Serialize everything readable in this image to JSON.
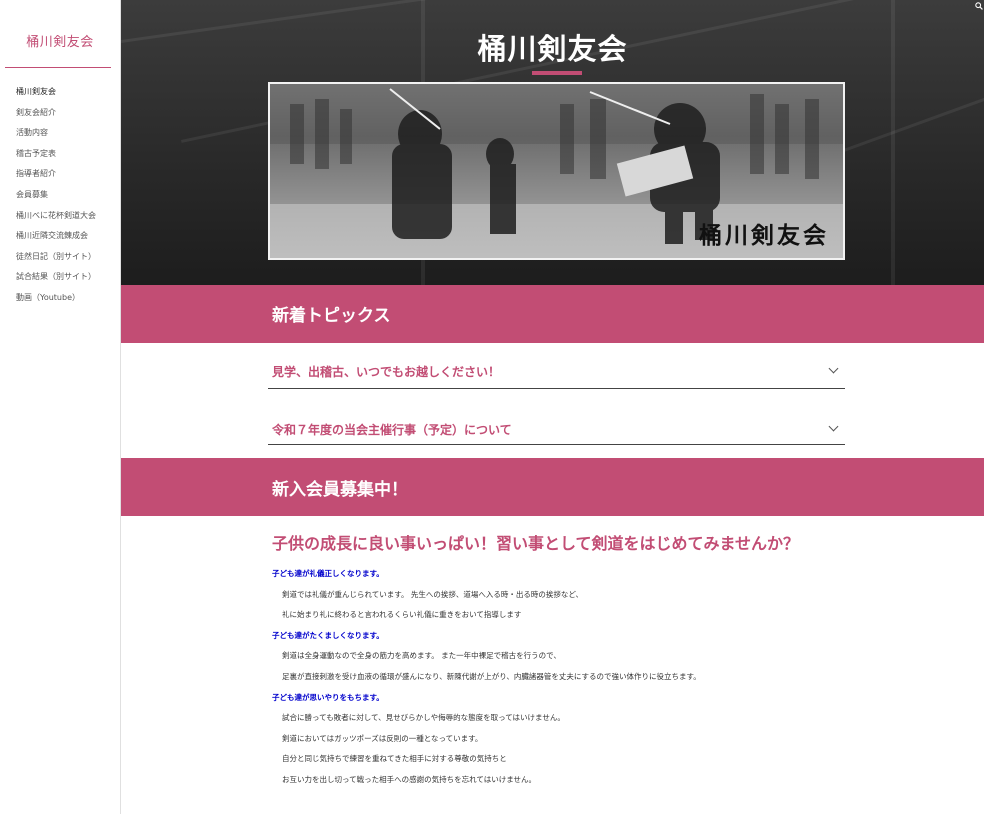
{
  "sidebar": {
    "site_title": "桶川剣友会",
    "items": [
      {
        "label": "桶川剣友会"
      },
      {
        "label": "剣友会紹介"
      },
      {
        "label": "活動内容"
      },
      {
        "label": "稽古予定表"
      },
      {
        "label": "指導者紹介"
      },
      {
        "label": "会員募集"
      },
      {
        "label": "桶川べに花杯剣道大会"
      },
      {
        "label": "桶川近隣交流錬成会"
      },
      {
        "label": "徒然日記（別サイト）"
      },
      {
        "label": "試合結果（別サイト）"
      },
      {
        "label": "動画（Youtube）"
      }
    ]
  },
  "header": {
    "title": "桶川剣友会",
    "banner_text": "桶川剣友会"
  },
  "topics": {
    "heading": "新着トピックス",
    "items": [
      {
        "label": "見学、出稽古、いつでもお越しください！"
      },
      {
        "label": "令和７年度の当会主催行事（予定）について"
      }
    ]
  },
  "recruit": {
    "heading": "新入会員募集中！",
    "headline": "子供の成長に良い事いっぱい！習い事として剣道をはじめてみませんか？",
    "lines": [
      {
        "type": "sub",
        "text": "子ども達が礼儀正しくなります。"
      },
      {
        "type": "para",
        "text": "剣道では礼儀が重んじられています。 先生への挨拶、道場へ入る時・出る時の挨拶など、"
      },
      {
        "type": "para",
        "text": "礼に始まり礼に終わると言われるくらい礼儀に重きをおいて指導します"
      },
      {
        "type": "sub",
        "text": "子ども達がたくましくなります。"
      },
      {
        "type": "para",
        "text": "剣道は全身運動なので全身の筋力を高めます。 また一年中裸足で稽古を行うので、"
      },
      {
        "type": "para",
        "text": "足裏が直接刺激を受け血液の循環が盛んになり、新陳代謝が上がり、内臓諸器管を丈夫にするので強い体作りに役立ちます。"
      },
      {
        "type": "sub",
        "text": "子ども達が思いやりをもちます。"
      },
      {
        "type": "para",
        "text": "試合に勝っても敗者に対して、見せびらかしや侮辱的な態度を取ってはいけません。"
      },
      {
        "type": "para",
        "text": "剣道においてはガッツポーズは反則の一種となっています。"
      },
      {
        "type": "para",
        "text": "自分と同じ気持ちで練習を重ねてきた相手に対する尊敬の気持ちと"
      },
      {
        "type": "para",
        "text": "お互い力を出し切って戦った相手への感謝の気持ちを忘れてはいけません。"
      }
    ]
  },
  "colors": {
    "accent": "#c24d74",
    "sub_heading": "#0000cc"
  },
  "icons": {
    "search": "search-icon",
    "expand": "chevron-down-icon"
  }
}
